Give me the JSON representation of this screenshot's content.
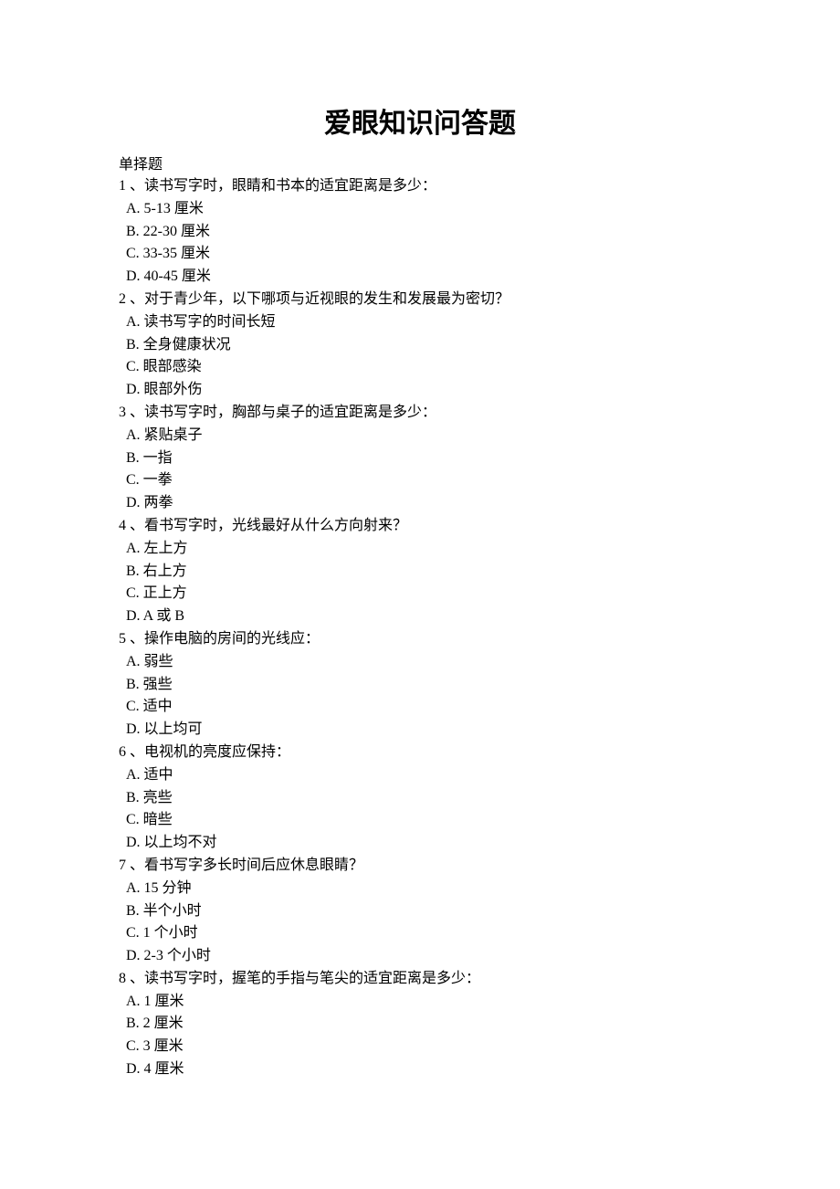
{
  "title": "爱眼知识问答题",
  "section_label": "单择题",
  "questions": [
    {
      "num": "1",
      "text": "、读书写字时，眼睛和书本的适宜距离是多少：",
      "options": [
        "A. 5-13 厘米",
        "B. 22-30 厘米",
        "C. 33-35 厘米",
        "D. 40-45 厘米"
      ]
    },
    {
      "num": "2",
      "text": "、对于青少年，以下哪项与近视眼的发生和发展最为密切？",
      "options": [
        "A.  读书写字的时间长短",
        "B.  全身健康状况",
        "C.  眼部感染",
        "D.  眼部外伤"
      ]
    },
    {
      "num": "3",
      "text": "、读书写字时，胸部与桌子的适宜距离是多少：",
      "options": [
        "A.  紧贴桌子",
        "B.  一指",
        "C.  一拳",
        "D.  两拳"
      ]
    },
    {
      "num": "4",
      "text": "、看书写字时，光线最好从什么方向射来？",
      "options": [
        "A.  左上方",
        "B.  右上方",
        "C.  正上方",
        "D. A 或 B"
      ]
    },
    {
      "num": "5",
      "text": "、操作电脑的房间的光线应：",
      "options": [
        "A.  弱些",
        "B.  强些",
        "C.  适中",
        "D.  以上均可"
      ]
    },
    {
      "num": "6",
      "text": "、电视机的亮度应保持：",
      "options": [
        "A.  适中",
        "B.  亮些",
        "C.  暗些",
        "D.  以上均不对"
      ]
    },
    {
      "num": "7",
      "text": "、看书写字多长时间后应休息眼睛？",
      "options": [
        "A. 15 分钟",
        "B.  半个小时",
        "C. 1 个小时",
        "D. 2-3 个小时"
      ]
    },
    {
      "num": "8",
      "text": "、读书写字时，握笔的手指与笔尖的适宜距离是多少：",
      "options": [
        "A. 1 厘米",
        "B. 2 厘米",
        "C. 3 厘米",
        "D. 4 厘米"
      ]
    }
  ]
}
